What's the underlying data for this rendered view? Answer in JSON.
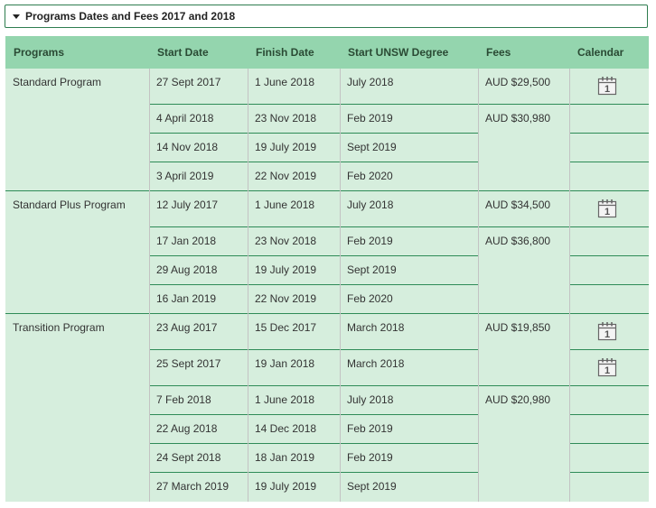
{
  "accordion": {
    "title": "Programs Dates and Fees 2017 and 2018",
    "expanded": true
  },
  "table": {
    "headers": [
      "Programs",
      "Start Date",
      "Finish Date",
      "Start UNSW Degree",
      "Fees",
      "Calendar"
    ],
    "programs": [
      {
        "name": "Standard Program",
        "rows": [
          {
            "start": "27 Sept 2017",
            "finish": "1 June 2018",
            "degree": "July 2018",
            "calendar": true
          },
          {
            "start": "4 April 2018",
            "finish": "23 Nov 2018",
            "degree": "Feb 2019",
            "calendar": false
          },
          {
            "start": "14 Nov 2018",
            "finish": "19 July 2019",
            "degree": "Sept 2019",
            "calendar": false
          },
          {
            "start": "3 April 2019",
            "finish": "22 Nov 2019",
            "degree": "Feb 2020",
            "calendar": false
          }
        ],
        "fees": [
          {
            "row": 0,
            "value": "AUD $29,500"
          },
          {
            "row": 1,
            "value": "AUD $30,980"
          }
        ]
      },
      {
        "name": "Standard Plus Program",
        "rows": [
          {
            "start": "12 July 2017",
            "finish": "1 June 2018",
            "degree": "July 2018",
            "calendar": true
          },
          {
            "start": "17 Jan 2018",
            "finish": "23 Nov 2018",
            "degree": "Feb 2019",
            "calendar": false
          },
          {
            "start": "29 Aug 2018",
            "finish": "19 July 2019",
            "degree": "Sept 2019",
            "calendar": false
          },
          {
            "start": "16 Jan 2019",
            "finish": "22 Nov 2019",
            "degree": "Feb 2020",
            "calendar": false
          }
        ],
        "fees": [
          {
            "row": 0,
            "value": "AUD $34,500"
          },
          {
            "row": 1,
            "value": "AUD $36,800"
          }
        ]
      },
      {
        "name": "Transition Program",
        "rows": [
          {
            "start": "23 Aug 2017",
            "finish": "15 Dec 2017",
            "degree": "March 2018",
            "calendar": true
          },
          {
            "start": "25 Sept 2017",
            "finish": "19 Jan 2018",
            "degree": "March 2018",
            "calendar": true
          },
          {
            "start": "7 Feb 2018",
            "finish": "1 June 2018",
            "degree": "July 2018",
            "calendar": false
          },
          {
            "start": "22 Aug 2018",
            "finish": "14 Dec 2018",
            "degree": "Feb 2019",
            "calendar": false
          },
          {
            "start": "24 Sept 2018",
            "finish": "18 Jan 2019",
            "degree": "Feb 2019",
            "calendar": false
          },
          {
            "start": "27 March 2019",
            "finish": "19 July 2019",
            "degree": "Sept 2019",
            "calendar": false
          }
        ],
        "fees": [
          {
            "row": 0,
            "value": "AUD $19,850"
          },
          {
            "row": 2,
            "value": "AUD $20,980"
          }
        ]
      }
    ],
    "calendar_icon": {
      "name": "calendar-icon",
      "glyph": "1"
    }
  },
  "colors": {
    "header_bg": "#94d5ae",
    "body_bg": "#d6eedd",
    "rule": "#2e8b57",
    "border": "#2e7d4f"
  }
}
